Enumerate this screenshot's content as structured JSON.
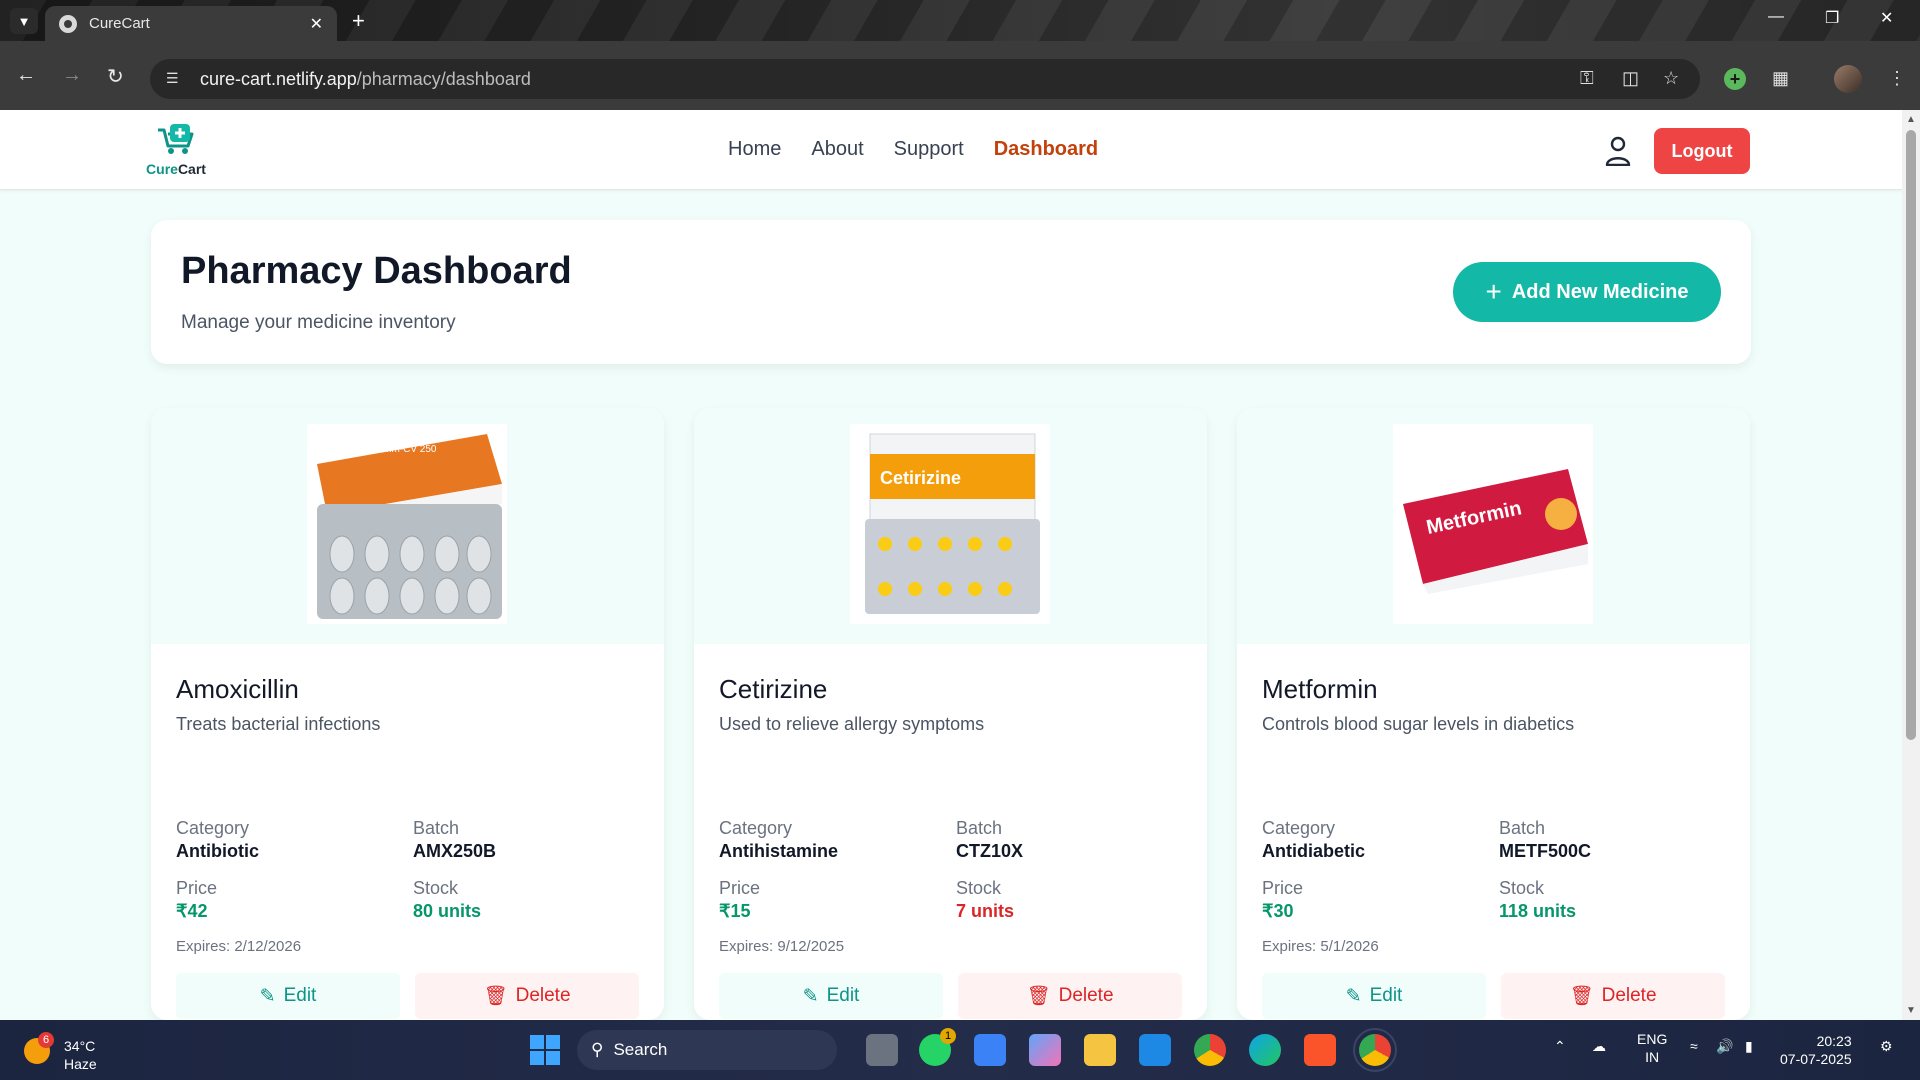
{
  "browser": {
    "tab_title": "CureCart",
    "url_host": "cure-cart.netlify.app",
    "url_path": "/pharmacy/dashboard"
  },
  "header": {
    "logo_text_a": "Cure",
    "logo_text_b": "Cart",
    "nav": [
      {
        "label": "Home"
      },
      {
        "label": "About"
      },
      {
        "label": "Support"
      },
      {
        "label": "Dashboard",
        "active": true
      }
    ],
    "logout_label": "Logout"
  },
  "hero": {
    "title": "Pharmacy Dashboard",
    "subtitle": "Manage your medicine inventory",
    "add_button": "Add New Medicine"
  },
  "labels": {
    "category": "Category",
    "batch": "Batch",
    "price": "Price",
    "stock": "Stock",
    "edit": "Edit",
    "delete": "Delete"
  },
  "medicines": [
    {
      "name": "Amoxicillin",
      "description": "Treats bacterial infections",
      "category": "Antibiotic",
      "batch": "AMX250B",
      "price": "₹42",
      "stock": "80 units",
      "stock_status": "ok",
      "expires": "Expires: 2/12/2026",
      "image_label": "Amoxyemm-CV 250"
    },
    {
      "name": "Cetirizine",
      "description": "Used to relieve allergy symptoms",
      "category": "Antihistamine",
      "batch": "CTZ10X",
      "price": "₹15",
      "stock": "7 units",
      "stock_status": "low",
      "expires": "Expires: 9/12/2025",
      "image_label": "Cetirizine"
    },
    {
      "name": "Metformin",
      "description": "Controls blood sugar levels in diabetics",
      "category": "Antidiabetic",
      "batch": "METF500C",
      "price": "₹30",
      "stock": "118 units",
      "stock_status": "ok",
      "expires": "Expires: 5/1/2026",
      "image_label": "Metformin"
    }
  ],
  "taskbar": {
    "temperature": "34°C",
    "condition": "Haze",
    "weather_badge": "6",
    "search_label": "Search",
    "whatsapp_badge": "1",
    "lang_top": "ENG",
    "lang_bottom": "IN",
    "time": "20:23",
    "date": "07-07-2025"
  },
  "colors": {
    "brand_teal": "#14b8a6",
    "active_nav": "#c2410c",
    "logout_red": "#ef4444",
    "stock_ok": "#059669",
    "stock_low": "#dc2626"
  }
}
